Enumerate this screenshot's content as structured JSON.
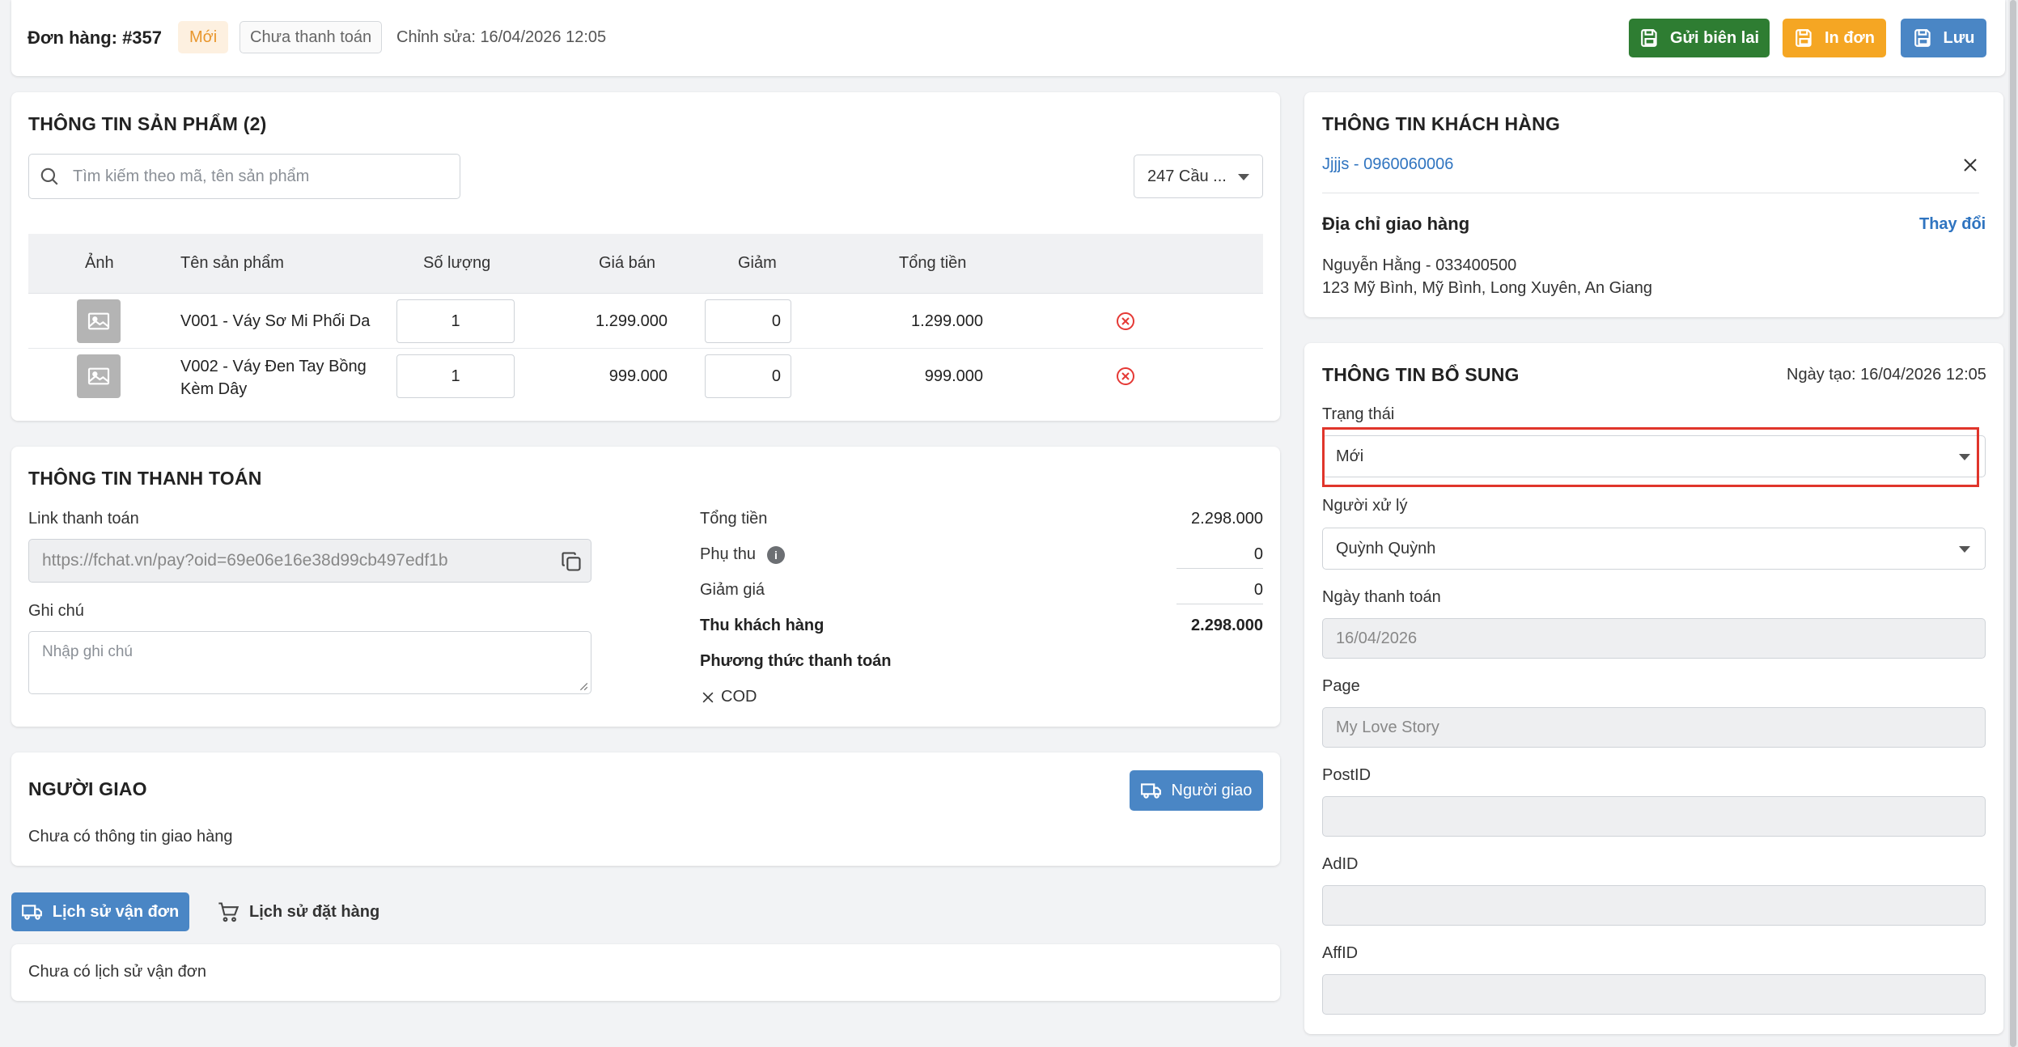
{
  "header": {
    "order_title": "Đơn hàng: #357",
    "status_badge": "Mới",
    "payment_badge": "Chưa thanh toán",
    "edited": "Chỉnh sửa: 16/04/2026 12:05",
    "btn_resend": "Gửi biên lai",
    "btn_print": "In đơn",
    "btn_save": "Lưu"
  },
  "products": {
    "title": "THÔNG TIN SẢN PHẨM (2)",
    "search_placeholder": "Tìm kiếm theo mã, tên sản phẩm",
    "warehouse_select": "247 Cầu ...",
    "columns": [
      "Ảnh",
      "Tên sản phẩm",
      "Số lượng",
      "Giá bán",
      "Giảm",
      "Tổng tiền"
    ],
    "rows": [
      {
        "name": "V001 - Váy Sơ Mi Phối Da",
        "qty": "1",
        "price": "1.299.000",
        "discount": "0",
        "total": "1.299.000"
      },
      {
        "name": "V002 - Váy Đen Tay Bồng Kèm Dây",
        "name_line1": "V002 - Váy Đen Tay Bồng",
        "name_line2": "Kèm Dây",
        "qty": "1",
        "price": "999.000",
        "discount": "0",
        "total": "999.000"
      }
    ]
  },
  "payment": {
    "title": "THÔNG TIN THANH TOÁN",
    "link_label": "Link thanh toán",
    "link_value": "https://fchat.vn/pay?oid=69e06e16e38d99cb497edf1b",
    "note_label": "Ghi chú",
    "note_placeholder": "Nhập ghi chú",
    "total_label": "Tổng tiền",
    "total_value": "2.298.000",
    "surcharge_label": "Phụ thu",
    "surcharge_value": "0",
    "discount_label": "Giảm giá",
    "discount_value": "0",
    "collect_label": "Thu khách hàng",
    "collect_value": "2.298.000",
    "method_label": "Phương thức thanh toán",
    "method_value": "COD"
  },
  "shipper": {
    "title": "NGƯỜI GIAO",
    "button": "Người giao",
    "empty": "Chưa có thông tin giao hàng"
  },
  "history_tabs": {
    "shipping": "Lịch sử vận đơn",
    "ordering": "Lịch sử đặt hàng",
    "empty": "Chưa có lịch sử vận đơn"
  },
  "customer": {
    "title": "THÔNG TIN KHÁCH HÀNG",
    "name_phone": "Jjjjs - 0960060006",
    "address_title": "Địa chỉ giao hàng",
    "change": "Thay đổi",
    "recipient": "Nguyễn Hằng - 033400500",
    "address": "123 Mỹ Bình, Mỹ Bình, Long Xuyên, An Giang"
  },
  "extra": {
    "title": "THÔNG TIN BỔ SUNG",
    "created": "Ngày tạo: 16/04/2026 12:05",
    "status_label": "Trạng thái",
    "status_value": "Mới",
    "handler_label": "Người xử lý",
    "handler_value": "Quỳnh Quỳnh",
    "paydate_label": "Ngày thanh toán",
    "paydate_value": "16/04/2026",
    "page_label": "Page",
    "page_value": "My Love Story",
    "postid_label": "PostID",
    "adid_label": "AdID",
    "affid_label": "AffID"
  },
  "colors": {
    "green": "#2e7d32",
    "orange": "#f5a623",
    "blue": "#4a86c5",
    "link": "#2f74c0",
    "danger": "#e53935",
    "highlight": "#e0352b"
  }
}
